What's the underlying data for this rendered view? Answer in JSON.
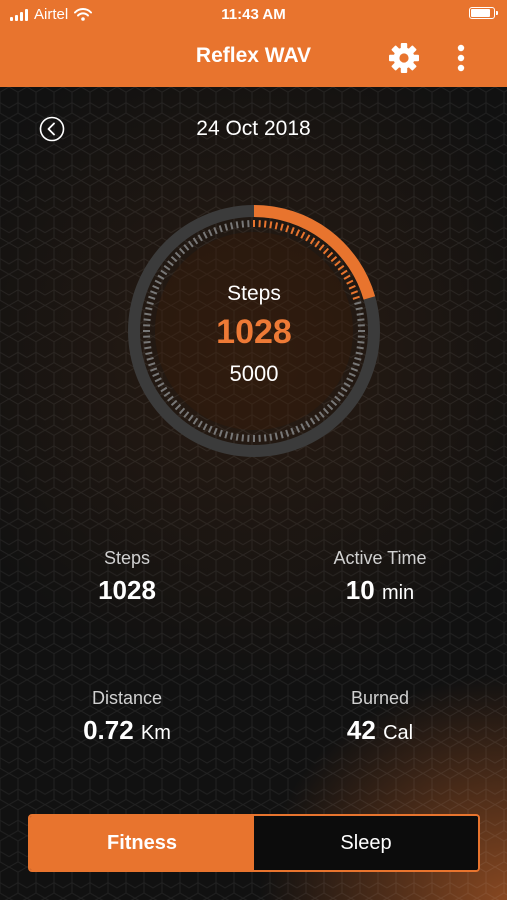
{
  "status_bar": {
    "carrier": "Airtel",
    "time": "11:43 AM",
    "battery_level": 0.9
  },
  "header": {
    "title": "Reflex WAV"
  },
  "date_nav": {
    "date": "24 Oct 2018"
  },
  "ring": {
    "label": "Steps",
    "value": "1028",
    "goal": "5000",
    "progress": 0.2056
  },
  "stats": {
    "steps": {
      "label": "Steps",
      "value": "1028",
      "unit": ""
    },
    "active_time": {
      "label": "Active Time",
      "value": "10",
      "unit": "min"
    },
    "distance": {
      "label": "Distance",
      "value": "0.72",
      "unit": "Km"
    },
    "burned": {
      "label": "Burned",
      "value": "42",
      "unit": "Cal"
    }
  },
  "tabs": {
    "fitness": "Fitness",
    "sleep": "Sleep",
    "active": "fitness"
  },
  "colors": {
    "accent": "#e8742e",
    "accent_text": "#ee7a36",
    "background": "#111111"
  }
}
